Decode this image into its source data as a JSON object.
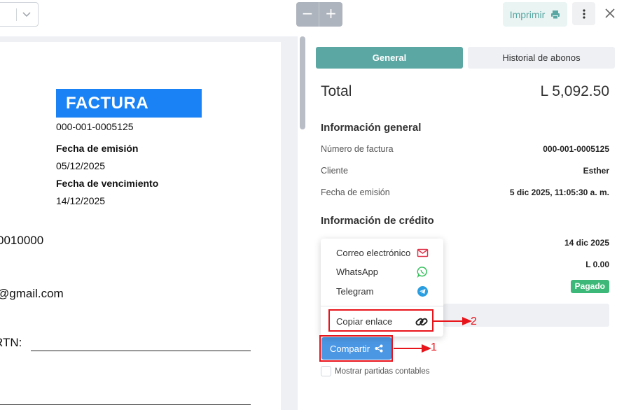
{
  "toolbar": {
    "zoom_out": "−",
    "zoom_in": "+",
    "print_label": "Imprimir",
    "more_icon": "vertical-dots-icon",
    "close_icon": "close-icon"
  },
  "document": {
    "title": "FACTURA",
    "number": "000-001-0005125",
    "issue_label": "Fecha de emisión",
    "issue_date": "05/12/2025",
    "due_label": "Fecha de vencimiento",
    "due_date": "14/12/2025",
    "partial_id": "0010000",
    "partial_email": "@gmail.com",
    "rtn_label": "RTN:"
  },
  "panel": {
    "tabs": [
      {
        "label": "General",
        "active": true
      },
      {
        "label": "Historial de abonos",
        "active": false
      }
    ],
    "total_label": "Total",
    "total_value": "L 5,092.50",
    "general_title": "Información general",
    "general_rows": [
      {
        "label": "Número de factura",
        "value": "000-001-0005125"
      },
      {
        "label": "Cliente",
        "value": "Esther"
      },
      {
        "label": "Fecha de emisión",
        "value": "5 dic 2025, 11:05:30 a. m."
      }
    ],
    "credit_title": "Información de crédito",
    "credit_values": [
      "14 dic 2025",
      "L 0.00"
    ],
    "status_badge": "Pagado",
    "share_label": "Compartir",
    "checkbox_label": "Mostrar partidas contables"
  },
  "share_menu": {
    "items": [
      {
        "label": "Correo electrónico",
        "icon": "email-icon"
      },
      {
        "label": "WhatsApp",
        "icon": "whatsapp-icon"
      },
      {
        "label": "Telegram",
        "icon": "telegram-icon"
      },
      {
        "label": "Copiar enlace",
        "icon": "link-icon"
      }
    ]
  },
  "annotations": {
    "step1": "1",
    "step2": "2"
  },
  "colors": {
    "accent_teal": "#5aa7a3",
    "share_blue": "#4b97e4",
    "factura_blue": "#1a82f5",
    "paid_green": "#3cb878",
    "annotation_red": "#e8141b"
  }
}
